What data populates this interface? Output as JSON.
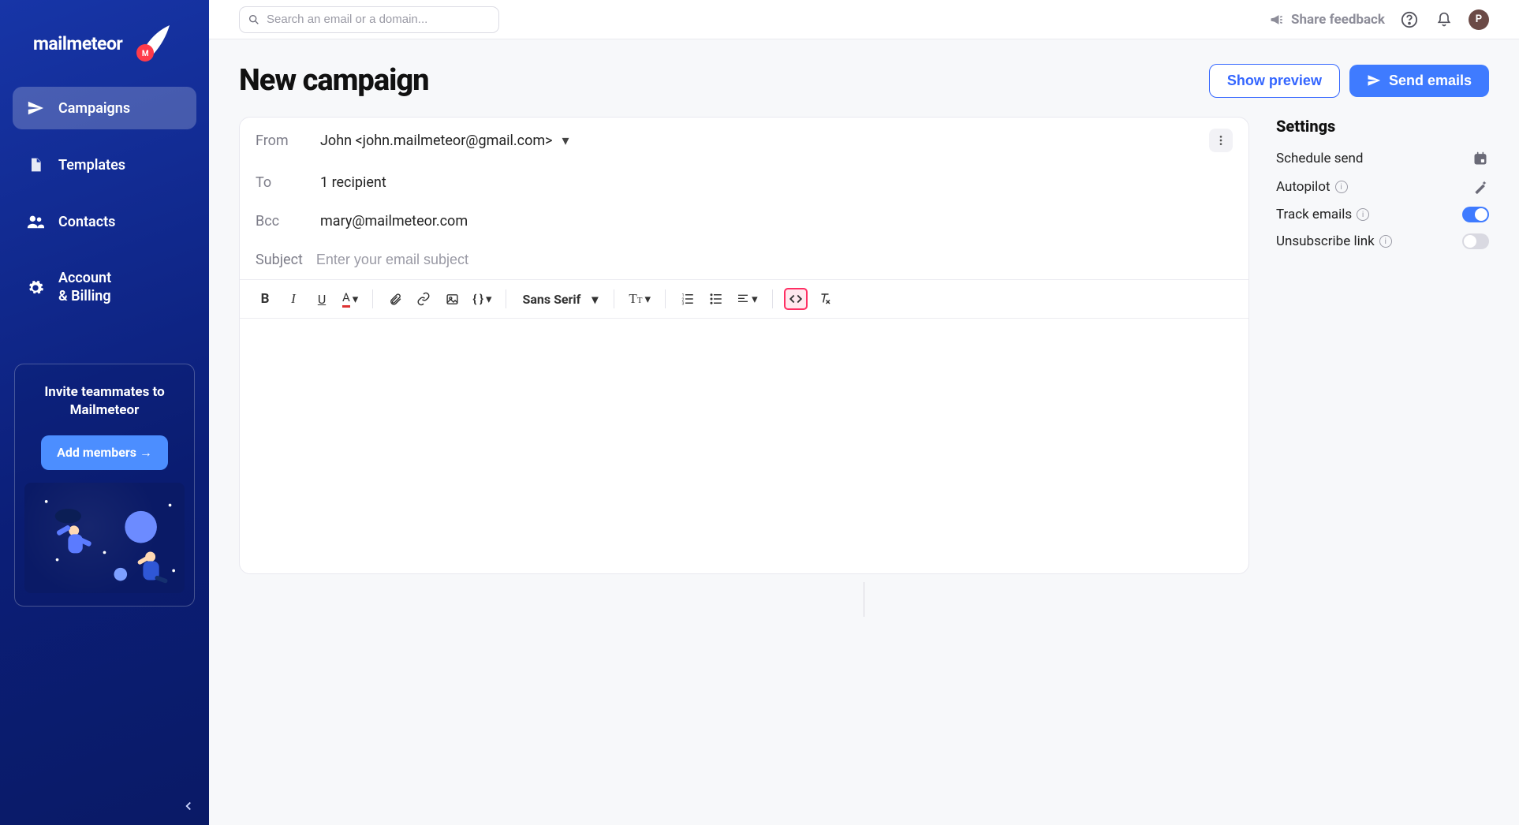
{
  "brand": {
    "name": "mailmeteor"
  },
  "sidebar": {
    "items": [
      {
        "label": "Campaigns"
      },
      {
        "label": "Templates"
      },
      {
        "label": "Contacts"
      },
      {
        "label_line1": "Account",
        "label_line2": "& Billing"
      }
    ],
    "invite": {
      "title_line1": "Invite teammates to",
      "title_line2": "Mailmeteor",
      "button": "Add members →"
    }
  },
  "topbar": {
    "search_placeholder": "Search an email or a domain...",
    "feedback": "Share feedback",
    "avatar_initial": "P"
  },
  "page": {
    "title": "New campaign",
    "show_preview": "Show preview",
    "send_emails": "Send emails"
  },
  "compose": {
    "labels": {
      "from": "From",
      "to": "To",
      "bcc": "Bcc",
      "subject": "Subject"
    },
    "from_value": "John <john.mailmeteor@gmail.com>",
    "to_value": "1 recipient",
    "bcc_value": "mary@mailmeteor.com",
    "subject_placeholder": "Enter your email subject",
    "font_family": "Sans Serif"
  },
  "settings": {
    "title": "Settings",
    "rows": {
      "schedule": "Schedule send",
      "autopilot": "Autopilot",
      "track": "Track emails",
      "unsubscribe": "Unsubscribe link"
    },
    "track_on": true,
    "unsubscribe_on": false
  }
}
